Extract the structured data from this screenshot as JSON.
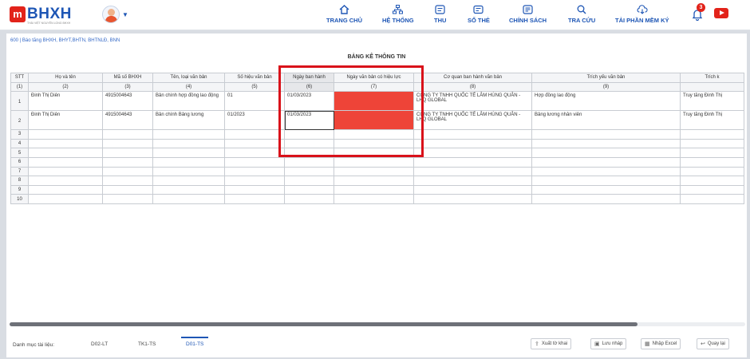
{
  "brand": {
    "logo_letter": "m",
    "name": "BHXH",
    "tagline": "THÁI VIỆT NGUYÊN LONG BHXH"
  },
  "nav": [
    {
      "label": "TRANG CHỦ",
      "icon": "home-icon"
    },
    {
      "label": "HỆ THỐNG",
      "icon": "sitemap-icon"
    },
    {
      "label": "THU",
      "icon": "receipt-icon"
    },
    {
      "label": "SỔ THẺ",
      "icon": "card-icon"
    },
    {
      "label": "CHÍNH SÁCH",
      "icon": "policy-icon"
    },
    {
      "label": "TRA CỨU",
      "icon": "search-icon"
    },
    {
      "label": "TẢI PHẦN MỀM KÝ",
      "icon": "cloud-download-icon"
    }
  ],
  "notifications": {
    "count": "3"
  },
  "breadcrumb": "600 | Báo tăng BHXH, BHYT,BHTN, BHTNLĐ, BNN",
  "title": "BẢNG KÊ THÔNG TIN",
  "table": {
    "headers": [
      "STT",
      "Họ và tên",
      "Mã số BHXH",
      "Tên, loại văn bản",
      "Số hiệu văn bản",
      "Ngày ban hành",
      "Ngày văn bản có hiệu lực",
      "Cơ quan ban hành văn bản",
      "Trích yếu văn bản",
      "Trích k"
    ],
    "numbers": [
      "(1)",
      "(2)",
      "(3)",
      "(4)",
      "(5)",
      "(6)",
      "(7)",
      "(8)",
      "(9)",
      ""
    ],
    "rows": [
      {
        "stt": "1",
        "name": "Đinh Thị Diên",
        "bhxh": "4915004643",
        "doc_type": "Bản chính hợp đồng lao động",
        "doc_no": "01",
        "issued": "01/03/2023",
        "effective": "",
        "agency": "CÔNG TY TNHH QUỐC TẾ LÂM HÙNG QUÂN - LHQ GLOBAL",
        "summary": "Hợp đồng lao động",
        "extra": "Truy tăng Đinh Thị"
      },
      {
        "stt": "2",
        "name": "Đinh Thị Diên",
        "bhxh": "4915004643",
        "doc_type": "Bản chính Bảng lương",
        "doc_no": "01/2023",
        "issued": "01/03/2023",
        "effective": "",
        "agency": "CÔNG TY TNHH QUỐC TẾ LÂM HÙNG QUÂN - LHQ GLOBAL",
        "summary": "Bảng lương nhân viên",
        "extra": "Truy tăng Đinh Thị"
      }
    ],
    "empty_rows": [
      "3",
      "4",
      "5",
      "6",
      "7",
      "8",
      "9",
      "10"
    ]
  },
  "footer": {
    "label": "Danh mục tài liệu:",
    "tabs": [
      "D02-LT",
      "TK1-TS",
      "D01-TS"
    ],
    "buttons": [
      "Xuất tờ khai",
      "Lưu nháp",
      "Nhập Excel",
      "Quay lại"
    ]
  },
  "colors": {
    "brand_blue": "#1e56b5",
    "brand_red": "#e2231a",
    "highlight_red": "#d9121a",
    "cell_fill": "#ee4438"
  }
}
